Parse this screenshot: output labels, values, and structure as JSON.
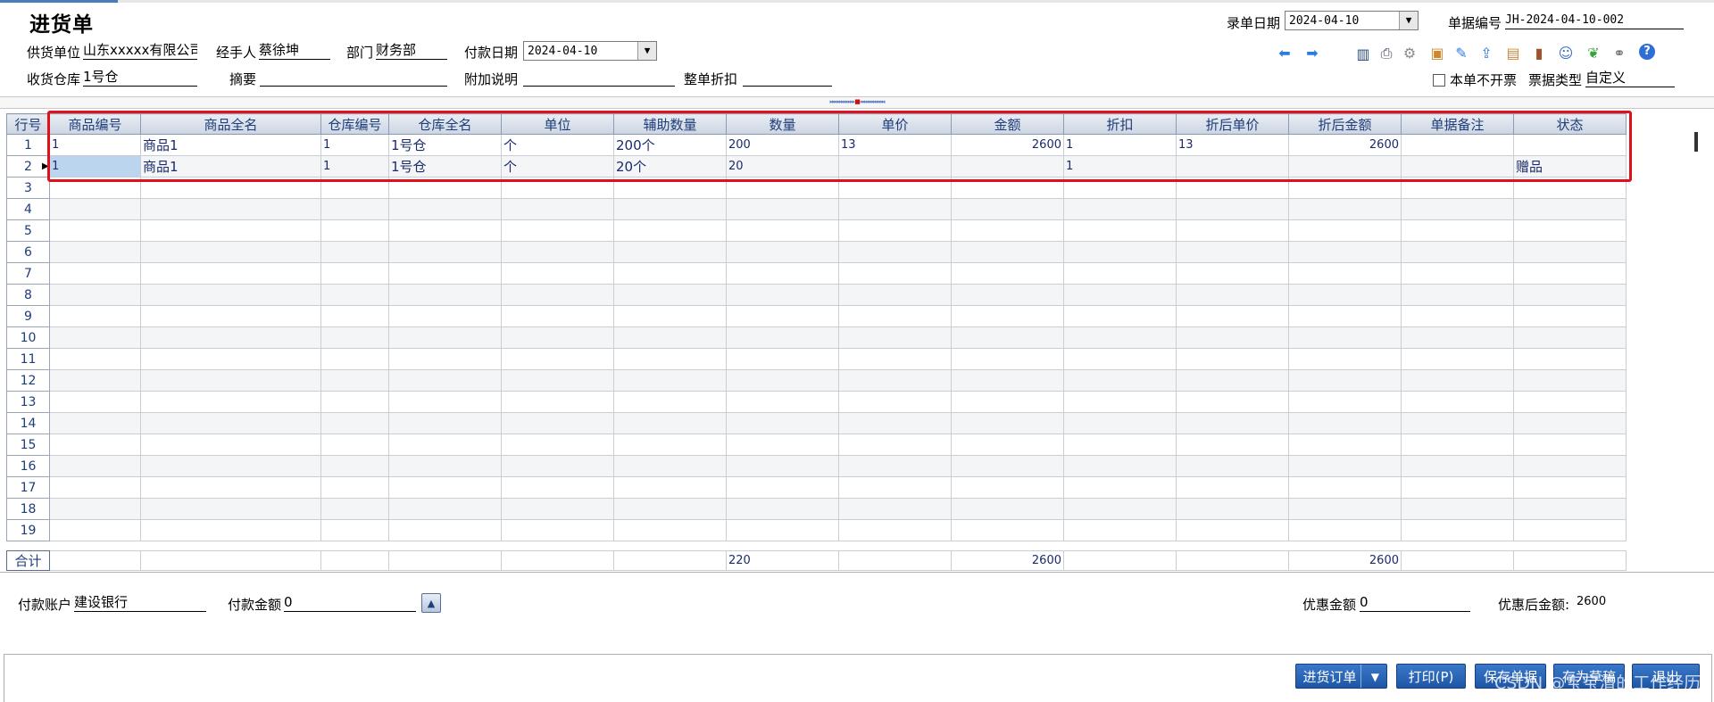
{
  "title": "进货单",
  "header": {
    "supplier_label": "供货单位",
    "supplier_value": "山东xxxxx有限公司",
    "handler_label": "经手人",
    "handler_value": "蔡徐坤",
    "dept_label": "部门",
    "dept_value": "财务部",
    "paydate_label": "付款日期",
    "paydate_value": "2024-04-10",
    "warehouse_label": "收货仓库",
    "warehouse_value": "1号仓",
    "summary_label": "摘要",
    "summary_value": "",
    "note_label": "附加说明",
    "note_value": "",
    "discount_label": "整单折扣",
    "discount_value": "",
    "entrydate_label": "录单日期",
    "entrydate_value": "2024-04-10",
    "docno_label": "单据编号",
    "docno_value": "JH-2024-04-10-002",
    "noinvoice_label": "本单不开票",
    "invoicetype_label": "票据类型",
    "invoicetype_value": "自定义"
  },
  "toolbar_icons": [
    "arrow-left-icon",
    "arrow-right-icon",
    "chart-icon",
    "printer-icon",
    "gear-icon",
    "add-icon",
    "edit-icon",
    "export-icon",
    "box-icon",
    "door-icon",
    "user-icon",
    "leaf-icon",
    "link-icon",
    "help-icon"
  ],
  "grid": {
    "columns": [
      "行号",
      "商品编号",
      "商品全名",
      "仓库编号",
      "仓库全名",
      "单位",
      "辅助数量",
      "数量",
      "单价",
      "金额",
      "折扣",
      "折后单价",
      "折后金额",
      "单据备注",
      "状态"
    ],
    "rows": [
      {
        "n": "1",
        "code": "1",
        "name": "商品1",
        "wcode": "1",
        "wname": "1号仓",
        "unit": "个",
        "aux": "200个",
        "qty": "200",
        "price": "13",
        "amount": "2600",
        "disc": "1",
        "dprice": "13",
        "damount": "2600",
        "note": "",
        "status": ""
      },
      {
        "n": "2",
        "code": "1",
        "name": "商品1",
        "wcode": "1",
        "wname": "1号仓",
        "unit": "个",
        "aux": "20个",
        "qty": "20",
        "price": "",
        "amount": "",
        "disc": "1",
        "dprice": "",
        "damount": "",
        "note": "",
        "status": "赠品"
      },
      {
        "n": "3"
      },
      {
        "n": "4"
      },
      {
        "n": "5"
      },
      {
        "n": "6"
      },
      {
        "n": "7"
      },
      {
        "n": "8"
      },
      {
        "n": "9"
      },
      {
        "n": "10"
      },
      {
        "n": "11"
      },
      {
        "n": "12"
      },
      {
        "n": "13"
      },
      {
        "n": "14"
      },
      {
        "n": "15"
      },
      {
        "n": "16"
      },
      {
        "n": "17"
      },
      {
        "n": "18"
      },
      {
        "n": "19"
      }
    ],
    "totals": {
      "label": "合计",
      "qty": "220",
      "amount": "2600",
      "damount": "2600"
    }
  },
  "footer": {
    "account_label": "付款账户",
    "account_value": "建设银行",
    "payamount_label": "付款金额",
    "payamount_value": "0",
    "discount_amount_label": "优惠金额",
    "discount_amount_value": "0",
    "after_discount_label": "优惠后金额:",
    "after_discount_value": "2600"
  },
  "buttons": {
    "order": "进货订单",
    "print": "打印(P)",
    "save": "保存单据",
    "draft": "存为草稿",
    "exit": "退出"
  },
  "watermark": "CSDN @宝宝清的工作经历"
}
